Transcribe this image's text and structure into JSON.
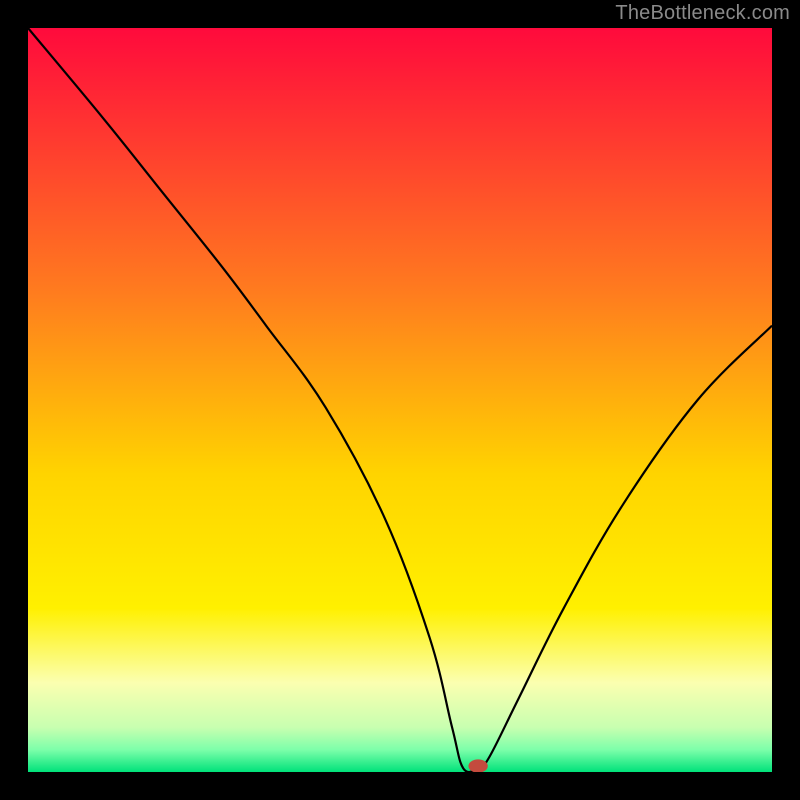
{
  "watermark": "TheBottleneck.com",
  "chart_data": {
    "type": "line",
    "title": "",
    "xlabel": "",
    "ylabel": "",
    "xlim": [
      0,
      100
    ],
    "ylim": [
      0,
      100
    ],
    "grid": false,
    "legend": false,
    "background_gradient": {
      "stops": [
        {
          "offset": 0,
          "color": "#ff0a3c"
        },
        {
          "offset": 35,
          "color": "#ff7a1f"
        },
        {
          "offset": 60,
          "color": "#ffd400"
        },
        {
          "offset": 78,
          "color": "#fff000"
        },
        {
          "offset": 88,
          "color": "#fbffb0"
        },
        {
          "offset": 94,
          "color": "#c8ffb0"
        },
        {
          "offset": 97,
          "color": "#7dffaa"
        },
        {
          "offset": 100,
          "color": "#00e27a"
        }
      ]
    },
    "series": [
      {
        "name": "bottleneck-curve",
        "color": "#000000",
        "x": [
          0,
          10,
          18,
          26,
          32,
          40,
          48,
          54,
          57,
          58.5,
          60.5,
          62,
          66,
          72,
          80,
          90,
          100
        ],
        "y": [
          100,
          88,
          78,
          68,
          60,
          49,
          34,
          18,
          6,
          0.5,
          0.5,
          2,
          10,
          22,
          36,
          50,
          60
        ]
      }
    ],
    "marker": {
      "x": 60.5,
      "y": 0.8,
      "rx": 1.3,
      "ry": 0.9,
      "color": "#c44b3e"
    }
  }
}
